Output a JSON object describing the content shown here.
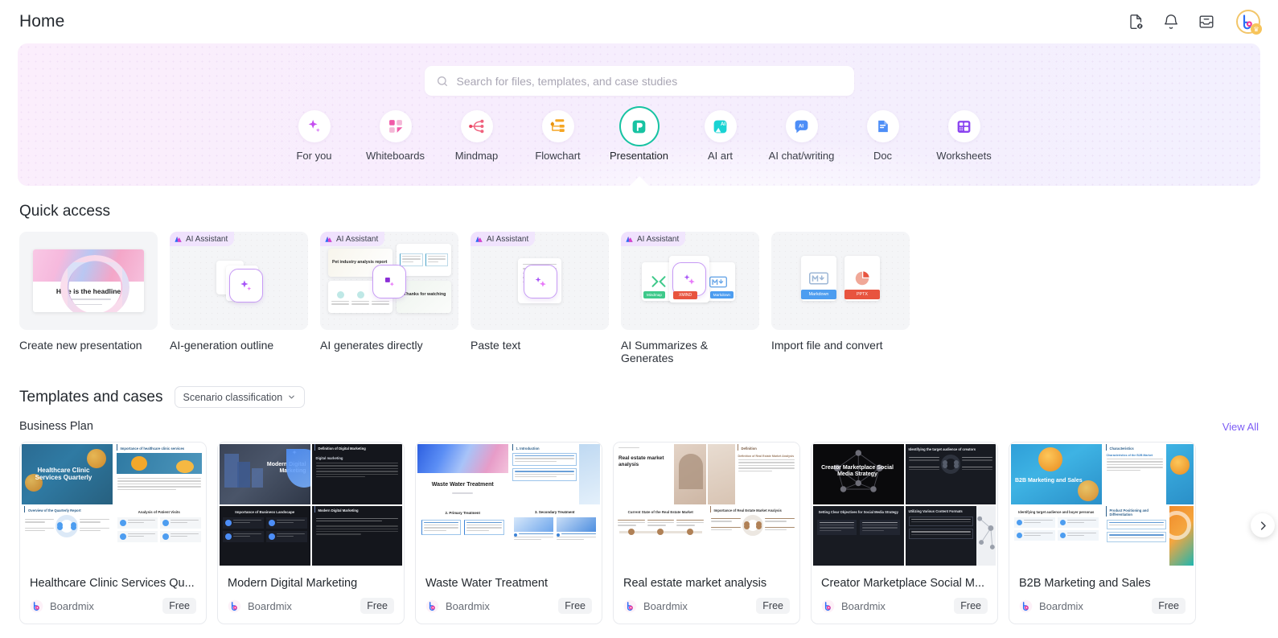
{
  "header": {
    "title": "Home",
    "icons": [
      {
        "name": "document-link-icon",
        "label": "Shared document"
      },
      {
        "name": "bell-icon",
        "label": "Notifications"
      },
      {
        "name": "inbox-icon",
        "label": "Inbox"
      }
    ],
    "avatar": {
      "name": "user-avatar",
      "letter": "b",
      "badge": "crown"
    }
  },
  "search": {
    "placeholder": "Search for files, templates, and case studies",
    "value": "",
    "icon": "search-icon"
  },
  "categories": [
    {
      "label": "For you",
      "icon": "sparkle-icon",
      "active": false
    },
    {
      "label": "Whiteboards",
      "icon": "whiteboard-icon",
      "active": false
    },
    {
      "label": "Mindmap",
      "icon": "mindmap-icon",
      "active": false
    },
    {
      "label": "Flowchart",
      "icon": "flowchart-icon",
      "active": false
    },
    {
      "label": "Presentation",
      "icon": "presentation-icon",
      "active": true
    },
    {
      "label": "AI art",
      "icon": "ai-art-icon",
      "active": false
    },
    {
      "label": "AI chat/writing",
      "icon": "ai-chat-icon",
      "active": false
    },
    {
      "label": "Doc",
      "icon": "doc-icon",
      "active": false
    },
    {
      "label": "Worksheets",
      "icon": "worksheets-icon",
      "active": false
    }
  ],
  "quick_access": {
    "title": "Quick access",
    "badge_label": "AI Assistant",
    "items": [
      {
        "label": "Create new presentation",
        "badge": false,
        "thumb": "slide-preview",
        "slide_headline": "Here is the headline"
      },
      {
        "label": "AI-generation outline",
        "badge": true,
        "thumb": "ai-outline"
      },
      {
        "label": "AI generates directly",
        "badge": true,
        "thumb": "ai-direct",
        "slide_a": "Pet industry analysis report",
        "slide_b": "Thanks for watching"
      },
      {
        "label": "Paste text",
        "badge": true,
        "thumb": "paste-text"
      },
      {
        "label": "AI Summarizes & Generates",
        "badge": true,
        "thumb": "ai-summarize",
        "chips": [
          "Mindmap",
          "XMIND",
          "Markdown"
        ]
      },
      {
        "label": "Import file and convert",
        "badge": false,
        "thumb": "import-convert",
        "chips": [
          "Markdown",
          "PPTX"
        ]
      }
    ]
  },
  "templates": {
    "title": "Templates and cases",
    "filter_label": "Scenario classification",
    "category": "Business Plan",
    "view_all": "View All",
    "author": "Boardmix",
    "price": "Free",
    "next_label": "Next",
    "cards": [
      {
        "name": "Healthcare Clinic Services Qu...",
        "cover_title": "Healthcare Clinic Services Quarterly",
        "slides": [
          "Importance of healthcare clinic services",
          "Overview of the Quarterly Report",
          "Analysis of Patient Visits"
        ],
        "theme": "blue-orange"
      },
      {
        "name": "Modern Digital Marketing",
        "cover_title": "Modern Digital Marketing",
        "slides": [
          "Definition of Digital Marketing",
          "Importance of Business Landscape",
          "Modern Digital Marketing"
        ],
        "theme": "dark-blue"
      },
      {
        "name": "Waste Water Treatment",
        "cover_title": "Waste Water Treatment",
        "slides": [
          "1. Introduction",
          "2. Primary Treatment",
          "3. Secondary Treatment"
        ],
        "theme": "light-blue"
      },
      {
        "name": "Real estate market analysis",
        "cover_title": "Real estate market analysis",
        "slides": [
          "Definition",
          "Current State of the Real Estate Market",
          "Importance of Real Estate Market Analysis"
        ],
        "theme": "beige"
      },
      {
        "name": "Creator Marketplace Social M...",
        "cover_title": "Creator Marketplace Social Media Strategy",
        "slides": [
          "Identifying the target audience of creators",
          "Setting Clear Objectives for Social Media Strategy",
          "Utilizing Various Content Formats"
        ],
        "theme": "black"
      },
      {
        "name": "B2B Marketing and Sales",
        "cover_title": "B2B Marketing and Sales",
        "slides": [
          "Characteristics",
          "Identifying target audience and buyer personas",
          "Product Positioning and Differentiation"
        ],
        "theme": "cyan-orange"
      }
    ]
  },
  "colors": {
    "accent_green": "#17c3a2",
    "accent_purple": "#7c5cf5",
    "banner_start": "#fbeefc",
    "banner_end": "#f3f0fe"
  }
}
